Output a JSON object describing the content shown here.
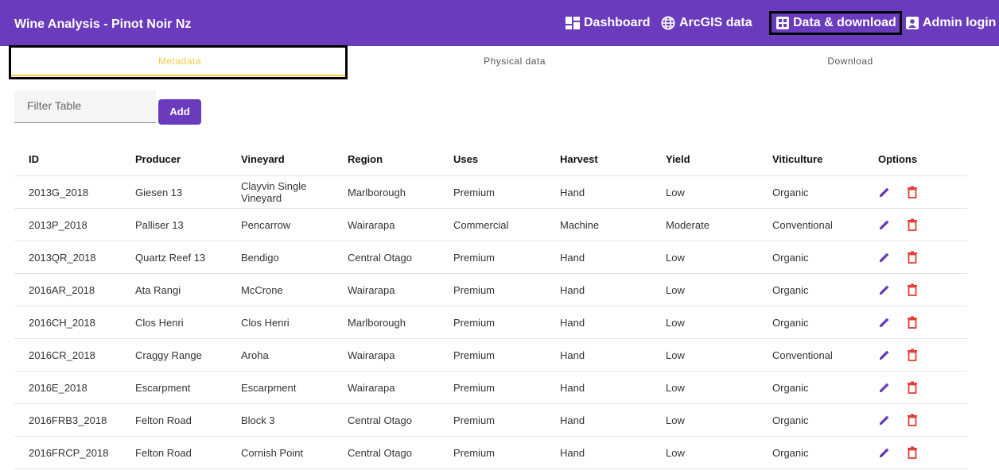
{
  "app": {
    "title": "Wine Analysis - Pinot Noir Nz"
  },
  "nav": {
    "dashboard": "Dashboard",
    "arcgis": "ArcGIS data",
    "data_download": "Data & download",
    "admin": "Admin login"
  },
  "icons": {
    "dashboard": "dashboard-icon",
    "arcgis": "globe-icon",
    "data_download": "table-grid-icon",
    "admin": "person-badge-icon",
    "edit": "pencil-icon",
    "delete": "trash-icon"
  },
  "colors": {
    "primary": "#6a3bbd",
    "active_tab": "#f2c94c",
    "delete": "#e53935",
    "edit": "#6a3bbd"
  },
  "tabs": {
    "metadata": "Metadata",
    "physical": "Physical data",
    "download": "Download"
  },
  "filter": {
    "placeholder": "Filter Table",
    "value": ""
  },
  "add_button": "Add",
  "table": {
    "headers": [
      "ID",
      "Producer",
      "Vineyard",
      "Region",
      "Uses",
      "Harvest",
      "Yield",
      "Viticulture",
      "Options"
    ],
    "rows": [
      [
        "2013G_2018",
        "Giesen 13",
        "Clayvin Single Vineyard",
        "Marlborough",
        "Premium",
        "Hand",
        "Low",
        "Organic"
      ],
      [
        "2013P_2018",
        "Palliser 13",
        "Pencarrow",
        "Wairarapa",
        "Commercial",
        "Machine",
        "Moderate",
        "Conventional"
      ],
      [
        "2013QR_2018",
        "Quartz Reef 13",
        "Bendigo",
        "Central Otago",
        "Premium",
        "Hand",
        "Low",
        "Organic"
      ],
      [
        "2016AR_2018",
        "Ata Rangi",
        "McCrone",
        "Wairarapa",
        "Premium",
        "Hand",
        "Low",
        "Organic"
      ],
      [
        "2016CH_2018",
        "Clos Henri",
        "Clos Henri",
        "Marlborough",
        "Premium",
        "Hand",
        "Low",
        "Organic"
      ],
      [
        "2016CR_2018",
        "Craggy Range",
        "Aroha",
        "Wairarapa",
        "Premium",
        "Hand",
        "Low",
        "Conventional"
      ],
      [
        "2016E_2018",
        "Escarpment",
        "Escarpment",
        "Wairarapa",
        "Premium",
        "Hand",
        "Low",
        "Organic"
      ],
      [
        "2016FRB3_2018",
        "Felton Road",
        "Block 3",
        "Central Otago",
        "Premium",
        "Hand",
        "Low",
        "Organic"
      ],
      [
        "2016FRCP_2018",
        "Felton Road",
        "Cornish Point",
        "Central Otago",
        "Premium",
        "Hand",
        "Low",
        "Organic"
      ]
    ]
  }
}
